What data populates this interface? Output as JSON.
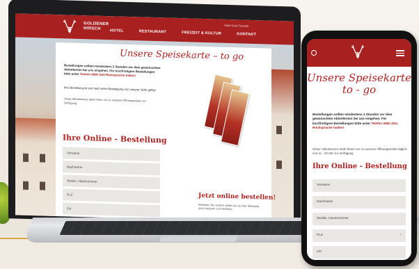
{
  "laptop": {
    "logo_line1": "GOLDENER",
    "logo_line2": "HIRSCH",
    "nav": [
      "HOTEL",
      "RESTAURANT",
      "FREIZEIT & KULTUR",
      "KONTAKT"
    ],
    "top_links": "Hotel   Gute Freunde",
    "script_title": "Unsere Speisekarte – to go",
    "intro_bold": "Bestellungen sollten mindestens 2 Stunden vor dem gewünschten Abholtermin bei uns eingehen. Für kurzfristigere Bestellungen bitte unter",
    "intro_phone": "Telefon 0906 3/24 Rückspreche halten!",
    "intro_confirm": "Ihre Bestellung ist erst nach einer Bestätigung von unserer Seite gültig!",
    "intro_hours": "Unser Abholservice steht Ihnen nur zu unseren Öffnungszeiten zur Verfügung",
    "order_title": "Ihre Online - Bestellung",
    "fields": [
      "Vorname",
      "Nachname",
      "Straße, Hausnummer",
      "PLZ",
      "Ort"
    ],
    "cta_title": "Jetzt online bestellen!",
    "cta_text": "Bestellen Sie einfach direkt hier auf der Webseite ganz bequem zum Abholen."
  },
  "phone": {
    "script_title": "Unsere Speisekarte to - go",
    "intro_bold": "Bestellungen sollten mindestens 2 Stunden vor dem gewünschten Abholtermin bei uns eingehen. Für kurzfristigere Bestellungen bitte unter",
    "intro_phone": "Telefon 0906 3/24 Rücksprache halten!",
    "intro_hours": "Unser Abholservice steht Ihnen nur zu unseren Öffnungszeiten täglich von 11 - 23 Uhr zur Verfügung",
    "order_title": "Ihre Online - Bestellung",
    "fields": [
      "Vorname",
      "Nachname",
      "Straße, Hausnummer",
      "PLZ",
      "Ort"
    ]
  },
  "colors": {
    "brand_red": "#a8201f",
    "title_red": "#b0211f",
    "field_bg": "#e9e7e3"
  },
  "icons": [
    "deer-logo-icon",
    "circle-icon",
    "hamburger-menu-icon",
    "chevron-right-icon"
  ]
}
